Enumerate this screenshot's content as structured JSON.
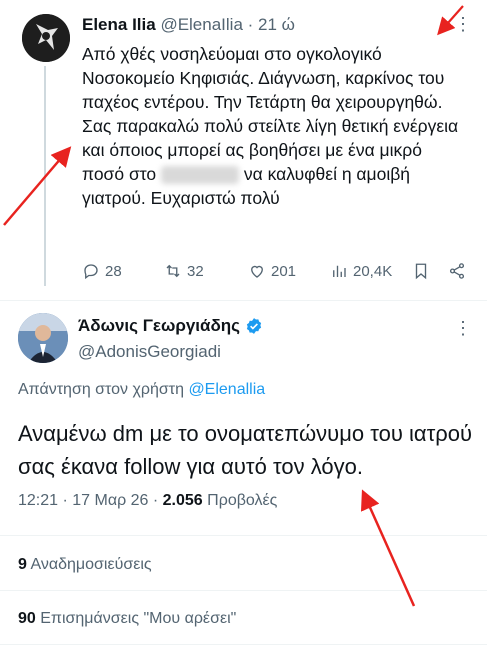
{
  "tweet": {
    "author_name": "Elena Ilia",
    "author_handle": "@ElenaIlia",
    "time": "· 21 ώ",
    "text": "Από χθές νοσηλεύομαι στο ογκολογικό Νοσοκομείο Κηφισιάς. Διάγνωση, καρκίνος του παχέος εντέρου. Την Τετάρτη θα χειρουργηθώ. Σας παρακαλώ πολύ στείλτε λίγη θετική ενέργεια και όποιος μπορεί ας βοηθήσει με ένα μικρό ποσό στο",
    "text_after_blur": "να καλυφθεί η αμοιβή γιατρού. Ευχαριστώ πολύ",
    "replies": "28",
    "reposts": "32",
    "likes": "201",
    "views": "20,4K"
  },
  "reply_tweet": {
    "author_name": "Άδωνις Γεωργιάδης",
    "author_handle": "@AdonisGeorgiadi",
    "reply_prefix": "Απάντηση στον χρήστη",
    "reply_to": "@Elenallia",
    "text": "Αναμένω dm με το ονοματεπώνυμο του ιατρού σας έκανα follow για αυτό τον λόγο.",
    "timestamp": "12:21 · 17 Μαρ 26 ·",
    "views_count": "2.056",
    "views_label": "Προβολές",
    "reposts_count": "9",
    "reposts_label": "Αναδημοσιεύσεις",
    "likes_count": "90",
    "likes_label": "Επισημάνσεις \"Μου αρέσει\""
  },
  "colors": {
    "accent": "#1d9bf0",
    "annotation": "#e8231f",
    "muted": "#536471"
  }
}
